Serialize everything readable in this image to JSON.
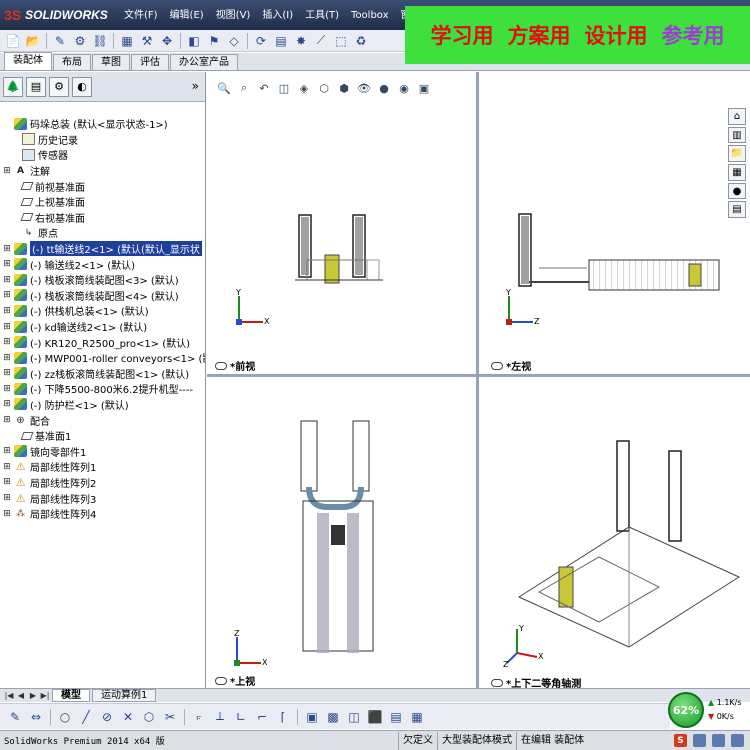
{
  "app": {
    "logo_text": "SOLIDWORKS",
    "logo_mark": "3S"
  },
  "menu": [
    "文件(F)",
    "编辑(E)",
    "视图(V)",
    "插入(I)",
    "工具(T)",
    "Toolbox",
    "窗口(W"
  ],
  "watermark": [
    "学习用",
    "方案用",
    "设计用",
    "参考用"
  ],
  "command_tabs": [
    "装配体",
    "布局",
    "草图",
    "评估",
    "办公室产品"
  ],
  "feature_tree": [
    {
      "label": "码垛总装  (默认<显示状态-1>)",
      "icon": "comp",
      "plus": "",
      "indent": 0
    },
    {
      "label": "历史记录",
      "icon": "folder",
      "plus": "",
      "indent": 1
    },
    {
      "label": "传感器",
      "icon": "sensor",
      "plus": "",
      "indent": 1
    },
    {
      "label": "注解",
      "icon": "note",
      "plus": "⊞",
      "indent": 0
    },
    {
      "label": "前视基准面",
      "icon": "plane",
      "plus": "",
      "indent": 1
    },
    {
      "label": "上视基准面",
      "icon": "plane",
      "plus": "",
      "indent": 1
    },
    {
      "label": "右视基准面",
      "icon": "plane",
      "plus": "",
      "indent": 1
    },
    {
      "label": "原点",
      "icon": "origin",
      "plus": "",
      "indent": 1
    },
    {
      "label": "(-) tt输送线2<1> (默认(默认_显示状",
      "icon": "comp",
      "plus": "⊞",
      "indent": 0,
      "selected": true
    },
    {
      "label": "(-) 输送线2<1> (默认)",
      "icon": "comp",
      "plus": "⊞",
      "indent": 0
    },
    {
      "label": "(-) 栈板滚筒线装配图<3> (默认)",
      "icon": "comp",
      "plus": "⊞",
      "indent": 0
    },
    {
      "label": "(-) 栈板滚筒线装配图<4> (默认)",
      "icon": "comp",
      "plus": "⊞",
      "indent": 0
    },
    {
      "label": "(-) 供栈机总装<1> (默认)",
      "icon": "comp",
      "plus": "⊞",
      "indent": 0
    },
    {
      "label": "(-) kd输送线2<1> (默认)",
      "icon": "comp",
      "plus": "⊞",
      "indent": 0
    },
    {
      "label": "(-) KR120_R2500_pro<1> (默认)",
      "icon": "comp",
      "plus": "⊞",
      "indent": 0
    },
    {
      "label": "(-) MWP001-roller conveyors<1> (默认",
      "icon": "comp",
      "plus": "⊞",
      "indent": 0
    },
    {
      "label": "(-) zz栈板滚筒线装配图<1> (默认)",
      "icon": "comp",
      "plus": "⊞",
      "indent": 0
    },
    {
      "label": "(-) 下降5500-800米6.2提升机型----",
      "icon": "comp",
      "plus": "⊞",
      "indent": 0
    },
    {
      "label": "(-) 防护栏<1> (默认)",
      "icon": "comp",
      "plus": "⊞",
      "indent": 0
    },
    {
      "label": "配合",
      "icon": "mate",
      "plus": "⊞",
      "indent": 0
    },
    {
      "label": "基准面1",
      "icon": "plane",
      "plus": "",
      "indent": 1
    },
    {
      "label": "镜向零部件1",
      "icon": "comp",
      "plus": "⊞",
      "indent": 0
    },
    {
      "label": "局部线性阵列1",
      "icon": "warn",
      "plus": "⊞",
      "indent": 0
    },
    {
      "label": "局部线性阵列2",
      "icon": "warn",
      "plus": "⊞",
      "indent": 0
    },
    {
      "label": "局部线性阵列3",
      "icon": "warn",
      "plus": "⊞",
      "indent": 0
    },
    {
      "label": "局部线性阵列4",
      "icon": "pattern",
      "plus": "⊞",
      "indent": 0
    }
  ],
  "viewports": [
    {
      "label": "*前视",
      "axes": [
        "Y",
        "X"
      ]
    },
    {
      "label": "*左视",
      "axes": [
        "Y",
        "Z"
      ]
    },
    {
      "label": "*上视",
      "axes": [
        "Z",
        "X"
      ]
    },
    {
      "label": "*上下二等角轴测",
      "axes": [
        "Y",
        "X",
        "Z"
      ]
    }
  ],
  "model_tabs": [
    "模型",
    "运动算例1"
  ],
  "perf": {
    "percent": "62%",
    "up": "1.1K/s",
    "down": "0K/s"
  },
  "status": {
    "version": "SolidWorks Premium 2014 x64 版",
    "cell1": "欠定义",
    "cell2": "大型装配体模式",
    "cell3": "在编辑 装配体"
  },
  "colors": {
    "titlebar": "#1f2c48",
    "selection": "#1e3f9c",
    "watermark_bg": "#3ee03e",
    "watermark_text": "#e01010",
    "perf_green": "#179a28"
  }
}
